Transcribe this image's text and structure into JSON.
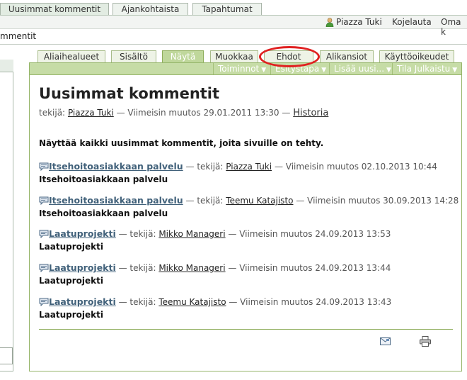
{
  "top_tabs": [
    "Uusimmat kommentit",
    "Ajankohtaista",
    "Tapahtumat"
  ],
  "userbar": {
    "user": "Piazza Tuki",
    "dashboard": "Kojelauta",
    "own": "Oma k"
  },
  "breadcrumb": "mmentit",
  "content_tabs": [
    "Aliaihealueet",
    "Sisältö",
    "Näytä",
    "Muokkaa",
    "Ehdot",
    "Alikansiot",
    "Käyttöoikeudet"
  ],
  "menus": [
    "Toiminnot",
    "Esitystapa",
    "Lisää uusi...",
    "Tila Julkaistu"
  ],
  "page": {
    "title": "Uusimmat kommentit",
    "meta_prefix": "tekijä:",
    "meta_author": "Piazza Tuki",
    "meta_modified": "— Viimeisin muutos 29.01.2011 13:30 —",
    "history": "Historia",
    "description": "Näyttää kaikki uusimmat kommentit, joita sivuille on tehty."
  },
  "entries": [
    {
      "title": "Itsehoitoasiakkaan palvelu",
      "by": "— tekijä:",
      "author": "Piazza Tuki",
      "modified": "— Viimeisin muutos 02.10.2013 10:44",
      "subtitle": "Itsehoitoasiakkaan palvelu"
    },
    {
      "title": "Itsehoitoasiakkaan palvelu",
      "by": "— tekijä:",
      "author": "Teemu Katajisto",
      "modified": "— Viimeisin muutos 30.09.2013 14:28",
      "subtitle": "Itsehoitoasiakkaan palvelu"
    },
    {
      "title": "Laatuprojekti",
      "by": "— tekijä:",
      "author": "Mikko Manageri",
      "modified": "— Viimeisin muutos 24.09.2013 13:53",
      "subtitle": "Laatuprojekti"
    },
    {
      "title": "Laatuprojekti",
      "by": "— tekijä:",
      "author": "Mikko Manageri",
      "modified": "— Viimeisin muutos 24.09.2013 13:44",
      "subtitle": "Laatuprojekti"
    },
    {
      "title": "Laatuprojekti",
      "by": "— tekijä:",
      "author": "Teemu Katajisto",
      "modified": "— Viimeisin muutos 24.09.2013 13:43",
      "subtitle": "Laatuprojekti"
    }
  ],
  "icons": {
    "comment": "comment-icon",
    "user": "user-icon",
    "mail": "mail-icon",
    "print": "print-icon"
  },
  "colors": {
    "accent_green": "#bfd79b",
    "link_blue": "#41617a",
    "highlight_red": "#e02020"
  }
}
